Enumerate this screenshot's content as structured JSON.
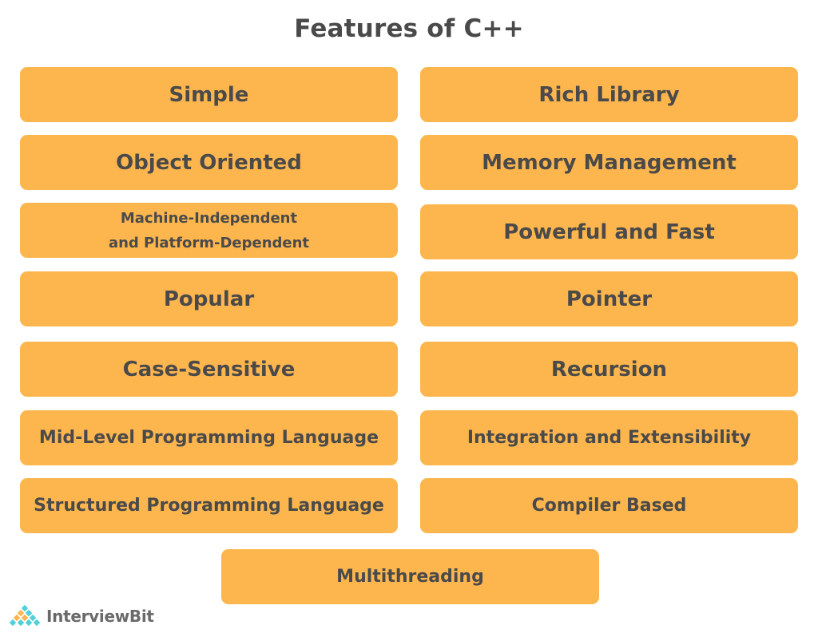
{
  "title": "Features of C++",
  "features": {
    "left": [
      "Simple",
      "Object Oriented",
      "Machine-Independent\nand Platform-Dependent",
      "Popular",
      "Case-Sensitive",
      "Mid-Level Programming Language",
      "Structured Programming Language"
    ],
    "right": [
      "Rich Library",
      "Memory Management",
      "Powerful and Fast",
      "Pointer",
      "Recursion",
      "Integration and Extensibility",
      "Compiler Based"
    ],
    "bottom": "Multithreading"
  },
  "brand": {
    "name": "InterviewBit",
    "colors": {
      "box": "#fdb64e",
      "text": "#4a4a4a",
      "logo_teal": "#4fd1d9",
      "logo_orange": "#fdb64e"
    }
  }
}
